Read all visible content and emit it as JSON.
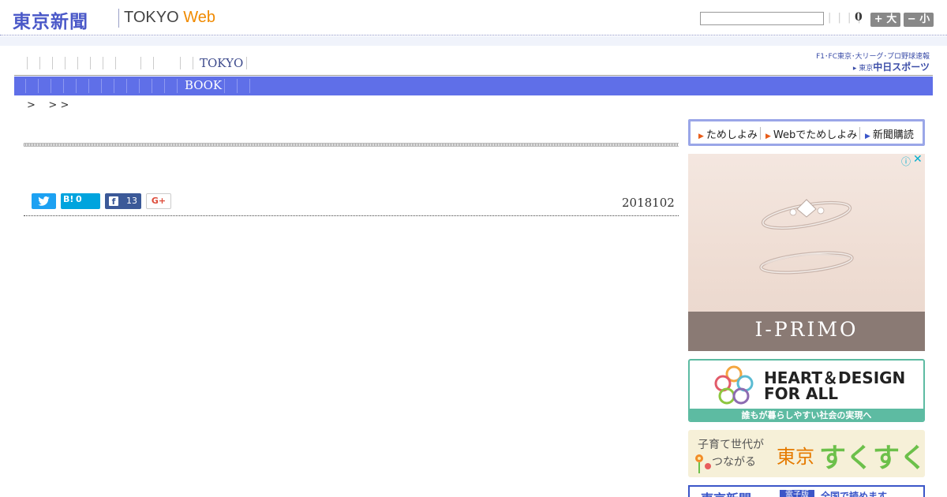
{
  "header": {
    "logo_jp": "東京新聞",
    "logo_en_prefix": "TOKYO ",
    "logo_en_web": "Web",
    "search_placeholder": "",
    "search_ticks": "| | | |",
    "count": "0",
    "btn_large": "+ 大",
    "btn_small": "− 小"
  },
  "nav_primary": {
    "active_item": "TOKYO"
  },
  "sports_link": {
    "line1": "F1･FC東京･大リーグ･プロ野球速報",
    "line2_prefix": "▸ 東京",
    "line2_main": "中日スポーツ"
  },
  "nav_secondary": {
    "active_item": "BOOK"
  },
  "breadcrumb": ">    > >",
  "article": {
    "date": "2018102",
    "share": {
      "hatena_label": "B!",
      "hatena_count": "0",
      "facebook_count": "13",
      "gplus_label": "G+"
    }
  },
  "sidebar": {
    "subscribe": {
      "trial": "ためしよみ",
      "web_trial": "Webでためしよみ",
      "subscribe": "新聞購読"
    },
    "ad_iprimo": {
      "brand": "I-PRIMO",
      "choices_icon": "ⓘ",
      "close_icon": "✕"
    },
    "ad_heart": {
      "line1": "HEART＆DESIGN",
      "line2": "FOR ALL",
      "footer": "誰もが暮らしやすい社会の実現へ"
    },
    "ad_sukusuku": {
      "line1": "子育て世代が",
      "line2": "つながる",
      "tokyo": "東京",
      "kana": "すくすく"
    },
    "ad_bottom": {
      "logo": "東京新聞",
      "tag": "電子版",
      "text": "全国で読めます"
    }
  },
  "colors": {
    "brand_blue": "#4a58c8",
    "nav_bar": "#5f6fe8",
    "web_orange": "#f08a00",
    "heart_green": "#5dbba2"
  }
}
